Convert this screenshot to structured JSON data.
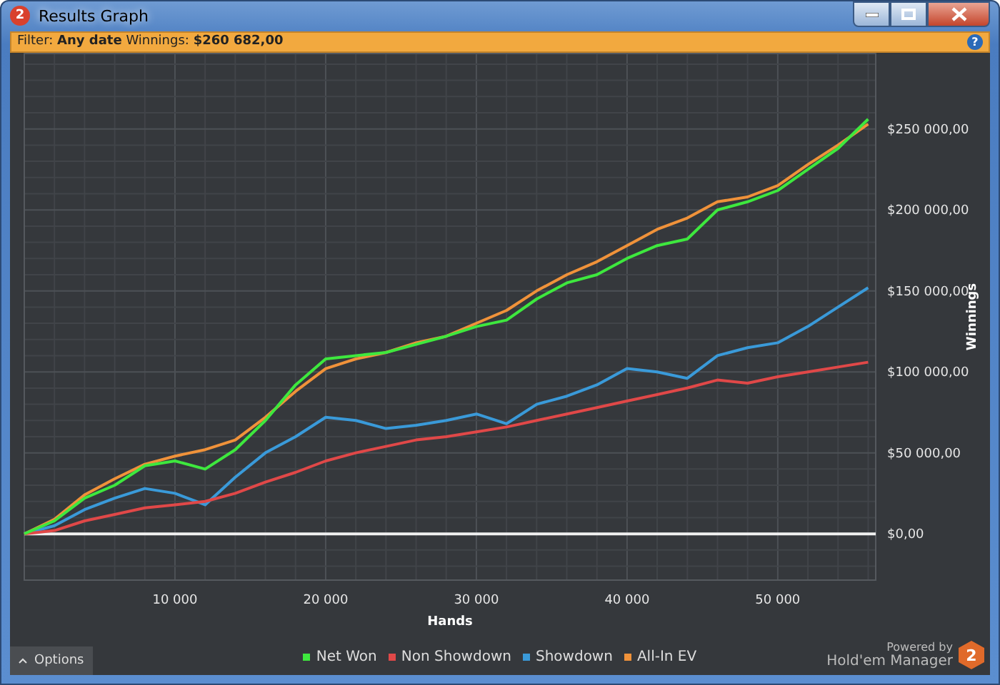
{
  "window": {
    "title": "Results Graph",
    "icon_text": "2"
  },
  "filter_bar": {
    "text": "Filter: **Any date** Winnings: **$260 682,00**",
    "help": "?"
  },
  "chart": {
    "chart_data": {
      "type": "line",
      "xlabel": "Hands",
      "ylabel": "Winnings",
      "grid": true,
      "x": [
        0,
        2000,
        4000,
        6000,
        8000,
        10000,
        12000,
        14000,
        16000,
        18000,
        20000,
        22000,
        24000,
        26000,
        28000,
        30000,
        32000,
        34000,
        36000,
        38000,
        40000,
        42000,
        44000,
        46000,
        48000,
        50000,
        52000,
        54000,
        56000
      ],
      "series": [
        {
          "name": "Net Won",
          "color": "#3ee83e",
          "values": [
            0,
            8000,
            22000,
            30000,
            42000,
            45000,
            40000,
            52000,
            70000,
            92000,
            108000,
            110000,
            112000,
            117000,
            122000,
            128000,
            132000,
            145000,
            155000,
            160000,
            170000,
            178000,
            182000,
            200000,
            205000,
            212000,
            225000,
            238000,
            256000
          ]
        },
        {
          "name": "Non Showdown",
          "color": "#e04848",
          "values": [
            0,
            2000,
            8000,
            12000,
            16000,
            18000,
            20000,
            25000,
            32000,
            38000,
            45000,
            50000,
            54000,
            58000,
            60000,
            63000,
            66000,
            70000,
            74000,
            78000,
            82000,
            86000,
            90000,
            95000,
            93000,
            97000,
            100000,
            103000,
            106000
          ]
        },
        {
          "name": "Showdown",
          "color": "#3a9ad9",
          "values": [
            0,
            5000,
            15000,
            22000,
            28000,
            25000,
            18000,
            35000,
            50000,
            60000,
            72000,
            70000,
            65000,
            67000,
            70000,
            74000,
            68000,
            80000,
            85000,
            92000,
            102000,
            100000,
            96000,
            110000,
            115000,
            118000,
            128000,
            140000,
            152000
          ]
        },
        {
          "name": "All-In EV",
          "color": "#f0923a",
          "values": [
            0,
            9000,
            24000,
            34000,
            43000,
            48000,
            52000,
            58000,
            72000,
            88000,
            102000,
            108000,
            112000,
            118000,
            122000,
            130000,
            138000,
            150000,
            160000,
            168000,
            178000,
            188000,
            195000,
            205000,
            208000,
            215000,
            228000,
            240000,
            253000
          ]
        }
      ],
      "xlim": [
        0,
        56500
      ],
      "ylim": [
        -29000,
        297000
      ],
      "xticks": [
        {
          "value": 10000,
          "label": "10 000"
        },
        {
          "value": 20000,
          "label": "20 000"
        },
        {
          "value": 30000,
          "label": "30 000"
        },
        {
          "value": 40000,
          "label": "40 000"
        },
        {
          "value": 50000,
          "label": "50 000"
        }
      ],
      "yticks": [
        {
          "value": 0,
          "label": "$0,00"
        },
        {
          "value": 50000,
          "label": "$50 000,00"
        },
        {
          "value": 100000,
          "label": "$100 000,00"
        },
        {
          "value": 150000,
          "label": "$150 000,00"
        },
        {
          "value": 200000,
          "label": "$200 000,00"
        },
        {
          "value": 250000,
          "label": "$250 000,00"
        }
      ]
    }
  },
  "options_button": {
    "label": "Options"
  },
  "branding": {
    "caption": "Powered by",
    "product": "Hold'em Manager",
    "logo_text": "2"
  }
}
